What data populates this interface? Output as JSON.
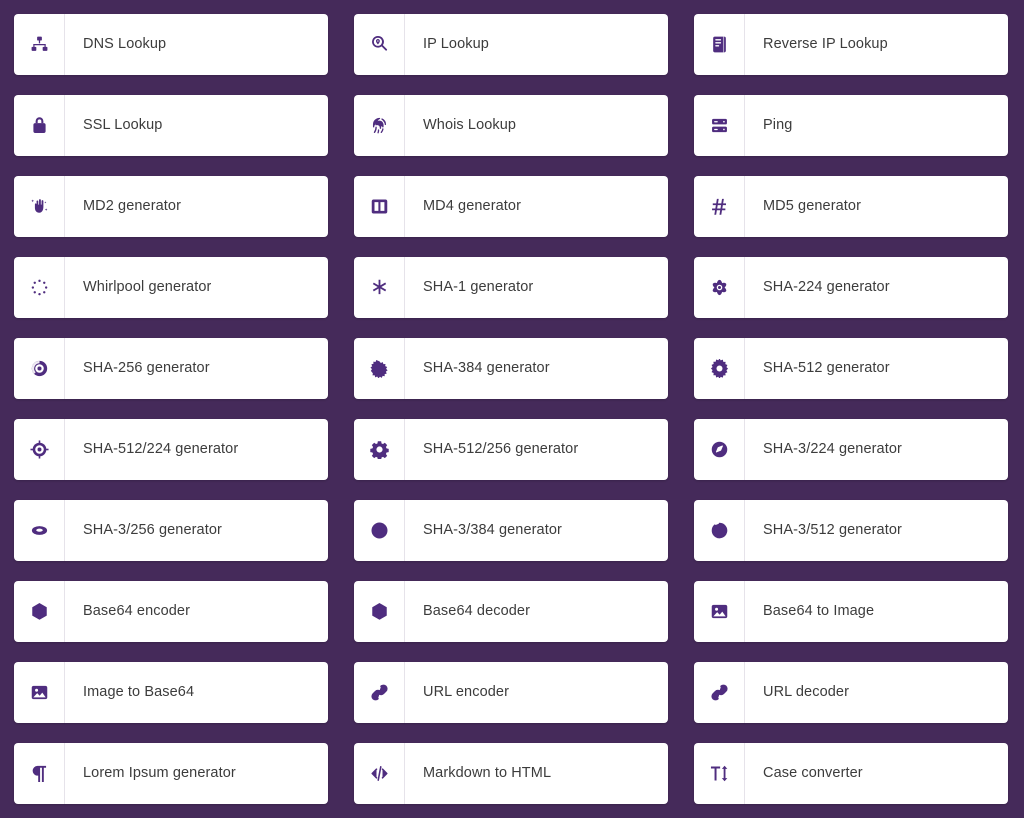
{
  "theme": {
    "background": "#452a5a",
    "card_background": "#ffffff",
    "icon_color": "#4f2d7f",
    "label_color": "#3c3c3c",
    "divider_color": "#e6e3ea"
  },
  "grid": {
    "columns": 3,
    "tools": [
      {
        "label": "DNS Lookup",
        "icon": "sitemap-icon"
      },
      {
        "label": "IP Lookup",
        "icon": "map-pin-search-icon"
      },
      {
        "label": "Reverse IP Lookup",
        "icon": "book-icon"
      },
      {
        "label": "SSL Lookup",
        "icon": "lock-icon"
      },
      {
        "label": "Whois Lookup",
        "icon": "fingerprint-icon"
      },
      {
        "label": "Ping",
        "icon": "server-icon"
      },
      {
        "label": "MD2 generator",
        "icon": "hand-sparkle-icon"
      },
      {
        "label": "MD4 generator",
        "icon": "panel-split-icon"
      },
      {
        "label": "MD5 generator",
        "icon": "hash-icon"
      },
      {
        "label": "Whirlpool generator",
        "icon": "dotted-circle-icon"
      },
      {
        "label": "SHA-1 generator",
        "icon": "asterisk-icon"
      },
      {
        "label": "SHA-224 generator",
        "icon": "atom-flower-icon"
      },
      {
        "label": "SHA-256 generator",
        "icon": "disc-icon"
      },
      {
        "label": "SHA-384 generator",
        "icon": "starburst-icon"
      },
      {
        "label": "SHA-512 generator",
        "icon": "gear-icon"
      },
      {
        "label": "SHA-512/224 generator",
        "icon": "crosshair-icon"
      },
      {
        "label": "SHA-512/256 generator",
        "icon": "cog-icon"
      },
      {
        "label": "SHA-3/224 generator",
        "icon": "compass-icon"
      },
      {
        "label": "SHA-3/256 generator",
        "icon": "ring-icon"
      },
      {
        "label": "SHA-3/384 generator",
        "icon": "lifebuoy-icon"
      },
      {
        "label": "SHA-3/512 generator",
        "icon": "circle-outline-icon"
      },
      {
        "label": "Base64 encoder",
        "icon": "cube-node-icon"
      },
      {
        "label": "Base64 decoder",
        "icon": "cube-node-icon"
      },
      {
        "label": "Base64 to Image",
        "icon": "image-icon"
      },
      {
        "label": "Image to Base64",
        "icon": "image-icon"
      },
      {
        "label": "URL encoder",
        "icon": "link-icon"
      },
      {
        "label": "URL decoder",
        "icon": "link-icon"
      },
      {
        "label": "Lorem Ipsum generator",
        "icon": "pilcrow-icon"
      },
      {
        "label": "Markdown to HTML",
        "icon": "code-icon"
      },
      {
        "label": "Case converter",
        "icon": "text-case-icon"
      }
    ]
  }
}
